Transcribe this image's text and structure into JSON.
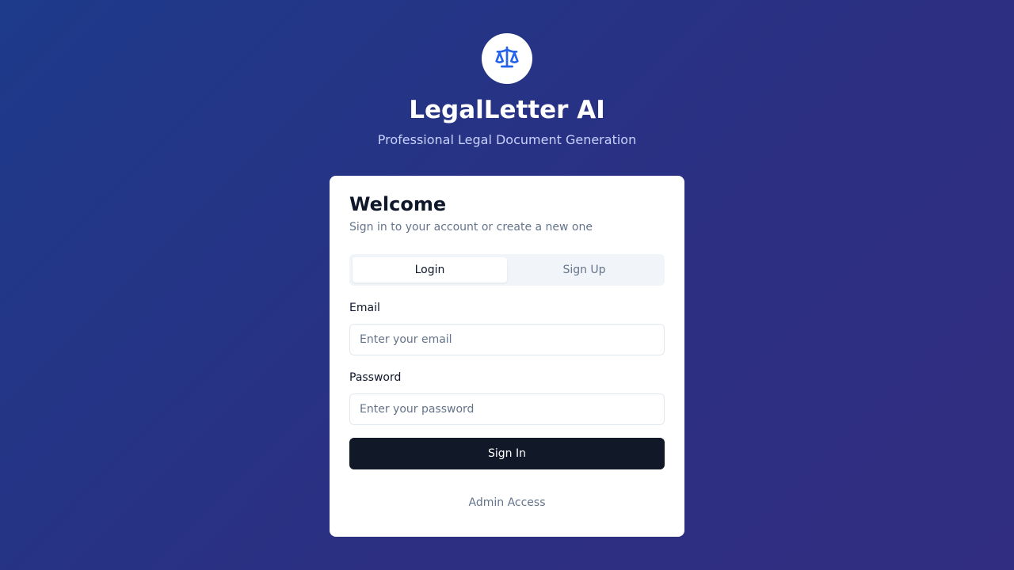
{
  "brand": {
    "logo_icon": "scale-of-justice-icon",
    "title": "LegalLetter AI",
    "subtitle": "Professional Legal Document Generation",
    "accent_color": "#2563eb"
  },
  "card": {
    "title": "Welcome",
    "description": "Sign in to your account or create a new one",
    "tabs": [
      {
        "label": "Login",
        "active": true
      },
      {
        "label": "Sign Up",
        "active": false
      }
    ],
    "email": {
      "label": "Email",
      "value": "",
      "placeholder": "Enter your email"
    },
    "password": {
      "label": "Password",
      "value": "",
      "placeholder": "Enter your password"
    },
    "submit_label": "Sign In",
    "admin_link": "Admin Access"
  },
  "colors": {
    "background_start": "#1e3a8a",
    "background_end": "#312e81",
    "button": "#111827"
  }
}
